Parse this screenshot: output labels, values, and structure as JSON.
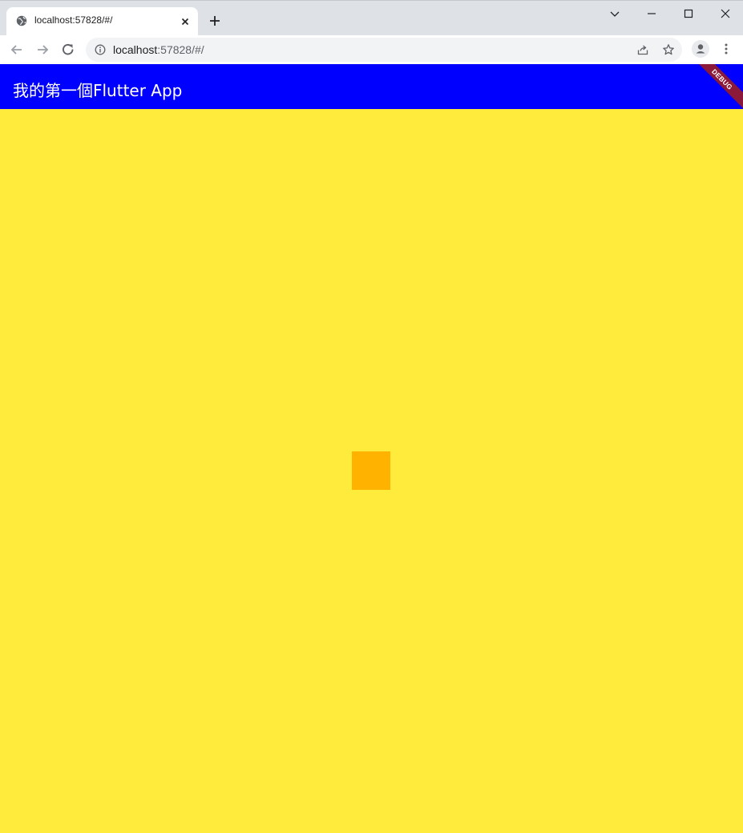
{
  "browser": {
    "tab": {
      "title": "localhost:57828/#/",
      "favicon": "globe-icon"
    },
    "address": {
      "host": "localhost",
      "path": ":57828/#/"
    }
  },
  "app": {
    "title": "我的第一個Flutter App",
    "debug_banner": "DEBUG",
    "colors": {
      "appbar": "#0000ff",
      "background": "#ffeb3b",
      "square": "#ffb300"
    }
  }
}
